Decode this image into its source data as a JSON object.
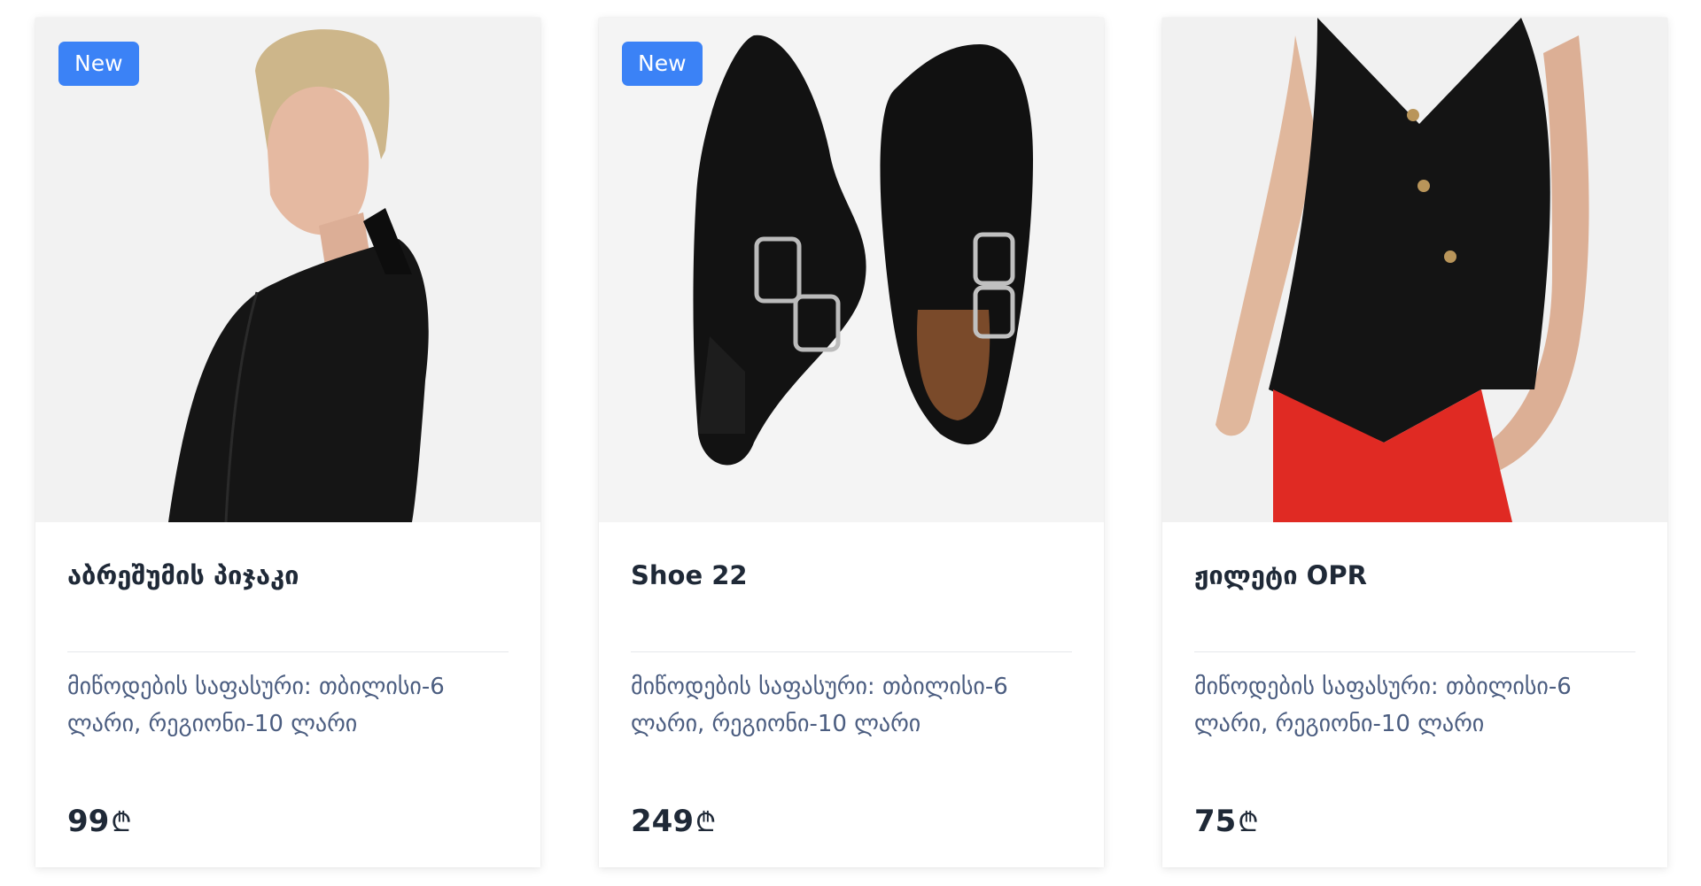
{
  "products": [
    {
      "badge": "New",
      "title": "აბრეშუმის პიჯაკი",
      "delivery": "მიწოდების საფასური: თბილისი-6 ლარი, რეგიონი-10 ლარი",
      "price": "99",
      "currency": "₾",
      "image": "woman-black-silk-jacket"
    },
    {
      "badge": "New",
      "title": "Shoe 22",
      "delivery": "მიწოდების საფასური: თბილისი-6 ლარი, რეგიონი-10 ლარი",
      "price": "249",
      "currency": "₾",
      "image": "black-leather-double-buckle-shoes"
    },
    {
      "title": "ჟილეტი OPR",
      "delivery": "მიწოდების საფასური: თბილისი-6 ლარი, რეგიონი-10 ლარი",
      "price": "75",
      "currency": "₾",
      "image": "black-vest-red-trousers"
    }
  ]
}
